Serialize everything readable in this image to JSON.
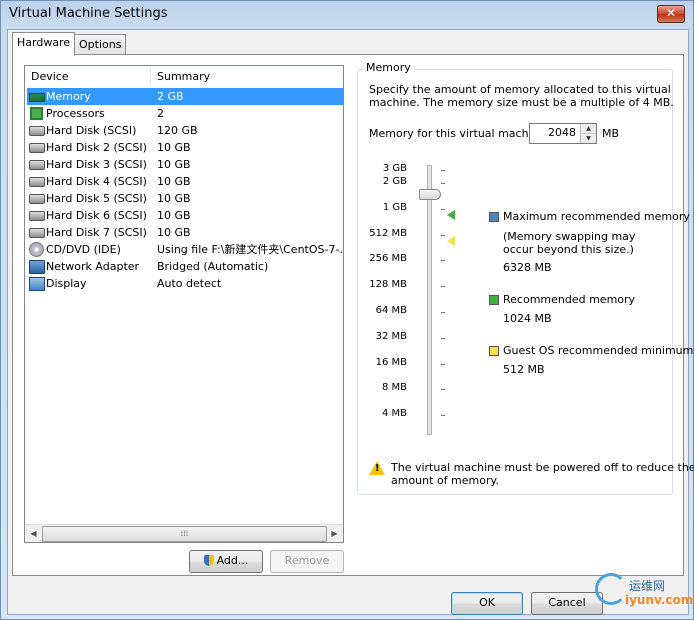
{
  "window": {
    "title": "Virtual Machine Settings"
  },
  "tabs": [
    {
      "label": "Hardware",
      "active": true
    },
    {
      "label": "Options",
      "active": false
    }
  ],
  "device_list": {
    "headers": {
      "device": "Device",
      "summary": "Summary"
    },
    "rows": [
      {
        "icon": "memory-icon",
        "device": "Memory",
        "summary": "2 GB",
        "selected": true
      },
      {
        "icon": "processor-icon",
        "device": "Processors",
        "summary": "2"
      },
      {
        "icon": "hard-disk-icon",
        "device": "Hard Disk (SCSI)",
        "summary": "120 GB"
      },
      {
        "icon": "hard-disk-icon",
        "device": "Hard Disk 2 (SCSI)",
        "summary": "10 GB"
      },
      {
        "icon": "hard-disk-icon",
        "device": "Hard Disk 3 (SCSI)",
        "summary": "10 GB"
      },
      {
        "icon": "hard-disk-icon",
        "device": "Hard Disk 4 (SCSI)",
        "summary": "10 GB"
      },
      {
        "icon": "hard-disk-icon",
        "device": "Hard Disk 5 (SCSI)",
        "summary": "10 GB"
      },
      {
        "icon": "hard-disk-icon",
        "device": "Hard Disk 6 (SCSI)",
        "summary": "10 GB"
      },
      {
        "icon": "hard-disk-icon",
        "device": "Hard Disk 7 (SCSI)",
        "summary": "10 GB"
      },
      {
        "icon": "cd-dvd-icon",
        "device": "CD/DVD (IDE)",
        "summary": "Using file F:\\新建文件夹\\CentOS-7-..."
      },
      {
        "icon": "network-adapter-icon",
        "device": "Network Adapter",
        "summary": "Bridged (Automatic)"
      },
      {
        "icon": "display-icon",
        "device": "Display",
        "summary": "Auto detect"
      }
    ]
  },
  "buttons": {
    "add": "Add...",
    "remove": "Remove",
    "ok": "OK",
    "cancel": "Cancel"
  },
  "memory": {
    "group_title": "Memory",
    "description_line1": "Specify the amount of memory allocated to this virtual",
    "description_line2": "machine. The memory size must be a multiple of 4 MB.",
    "field_label": "Memory for this virtual machine:",
    "value": "2048",
    "unit": "MB",
    "slider_labels": [
      "3 GB",
      "2 GB",
      "1 GB",
      "512 MB",
      "256 MB",
      "128 MB",
      "64 MB",
      "32 MB",
      "16 MB",
      "8 MB",
      "4 MB"
    ],
    "legend": {
      "max_title": "Maximum recommended memory",
      "max_note_line1": "(Memory swapping may",
      "max_note_line2": "occur beyond this size.)",
      "max_value": "6328 MB",
      "rec_title": "Recommended memory",
      "rec_value": "1024 MB",
      "guest_title": "Guest OS recommended minimum",
      "guest_value": "512 MB"
    },
    "warning_line1": "The virtual machine must be powered off to reduce the",
    "warning_line2": "amount of memory."
  },
  "colors": {
    "max": "#4f81bd",
    "recommended": "#3cb043",
    "guest_min": "#f2e24a",
    "selection": "#3399ff"
  },
  "watermark": {
    "line1": "运维网",
    "line2": "iyunv.com"
  }
}
